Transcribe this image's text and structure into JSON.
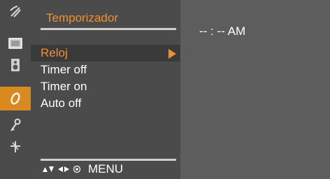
{
  "menu": {
    "title": "Temporizador",
    "items": [
      {
        "label": "Reloj",
        "selected": true
      },
      {
        "label": "Timer off",
        "selected": false
      },
      {
        "label": "Timer on",
        "selected": false
      },
      {
        "label": "Auto off",
        "selected": false
      }
    ]
  },
  "sidebar_icons": [
    {
      "name": "satellite-dish-icon",
      "active": false
    },
    {
      "name": "picture-icon",
      "active": false
    },
    {
      "name": "speaker-icon",
      "active": false
    },
    {
      "name": "clock-timer-icon",
      "active": true
    },
    {
      "name": "key-icon",
      "active": false
    },
    {
      "name": "tools-icon",
      "active": false
    }
  ],
  "value": {
    "clock": "-- : -- AM"
  },
  "footer": {
    "menu_label": "MENU",
    "nav_icons": [
      "up-down-arrows-icon",
      "left-right-arrows-icon",
      "ok-dot-icon"
    ]
  },
  "colors": {
    "accent": "#f3902a",
    "panel": "#4b4b4b",
    "background": "#5d5d5d",
    "active_icon_bg": "#d98a1e"
  }
}
